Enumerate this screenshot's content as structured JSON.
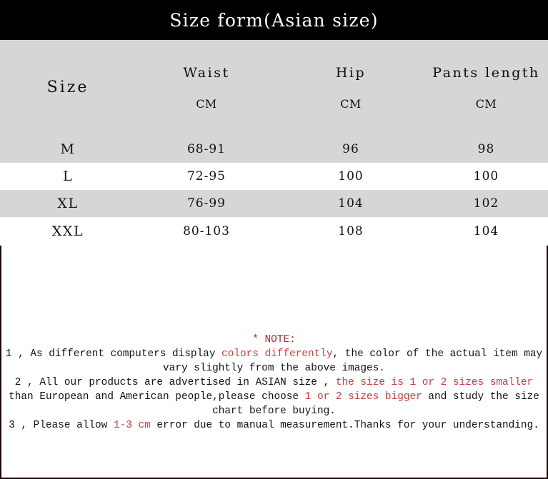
{
  "title": "Size form(Asian size)",
  "table": {
    "headers": [
      {
        "name": "Size",
        "unit": ""
      },
      {
        "name": "Waist",
        "unit": "CM"
      },
      {
        "name": "Hip",
        "unit": "CM"
      },
      {
        "name": "Pants length",
        "unit": "CM"
      }
    ],
    "rows": [
      {
        "size": "M",
        "waist": "68-91",
        "hip": "96",
        "pants_length": "98"
      },
      {
        "size": "L",
        "waist": "72-95",
        "hip": "100",
        "pants_length": "100"
      },
      {
        "size": "XL",
        "waist": "76-99",
        "hip": "104",
        "pants_length": "102"
      },
      {
        "size": "XXL",
        "waist": "80-103",
        "hip": "108",
        "pants_length": "104"
      }
    ]
  },
  "notes": {
    "heading": "* NOTE:",
    "item1": {
      "pre": "1 , As different computers display ",
      "highlight": "colors differently",
      "post": ", the color of the actual item may vary slightly from the above images."
    },
    "item2": {
      "pre": "2 , All our products are advertised in ASIAN size , ",
      "highlight1": "the size is 1 or 2 sizes smaller",
      "mid": " than European and American people,please choose ",
      "highlight2": "1 or 2 sizes bigger",
      "post": " and study the size chart before buying."
    },
    "item3": {
      "pre": "3 , Please allow ",
      "highlight": "1-3 cm",
      "post": " error due to manual measurement.Thanks for your understanding."
    }
  },
  "colors": {
    "banner_bg": "#000000",
    "banner_text": "#ffffff",
    "header_cell_bg": "#d6d6d6",
    "row_alt_bg": "#d6d6d6",
    "row_bg": "#ffffff",
    "grid_line": "#1d0707",
    "note_red": "#cf3b3b",
    "note_heading_red": "#b32b2b",
    "body_text": "#15100f"
  }
}
